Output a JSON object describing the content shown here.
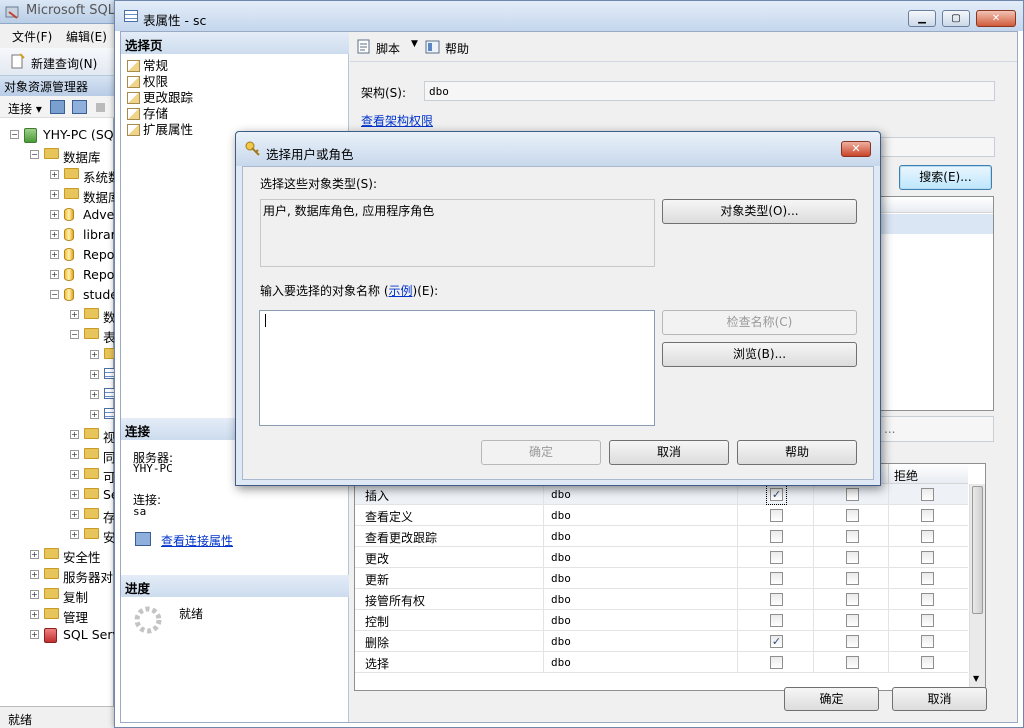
{
  "ssms": {
    "title": "Microsoft SQL",
    "menu": [
      "文件(F)",
      "编辑(E)"
    ],
    "new_query": "新建查询(N)",
    "object_explorer": {
      "header": "对象资源管理器",
      "connect": "连接",
      "tree": [
        {
          "label": "YHY-PC (SQ",
          "icon": "server-icon",
          "level": 0,
          "expander": "−"
        },
        {
          "label": "数据库",
          "icon": "folder-icon",
          "level": 1,
          "expander": "−"
        },
        {
          "label": "系统数",
          "icon": "folder-icon",
          "level": 2,
          "expander": "+"
        },
        {
          "label": "数据库",
          "icon": "folder-icon",
          "level": 2,
          "expander": "+"
        },
        {
          "label": "Adve",
          "icon": "database-icon",
          "level": 2,
          "expander": "+"
        },
        {
          "label": "librar",
          "icon": "database-icon",
          "level": 2,
          "expander": "+"
        },
        {
          "label": "Repo",
          "icon": "database-icon",
          "level": 2,
          "expander": "+"
        },
        {
          "label": "Repo",
          "icon": "database-icon",
          "level": 2,
          "expander": "+"
        },
        {
          "label": "stude",
          "icon": "database-icon",
          "level": 2,
          "expander": "−"
        },
        {
          "label": "数",
          "icon": "folder-icon",
          "level": 3,
          "expander": "+"
        },
        {
          "label": "表",
          "icon": "folder-icon",
          "level": 3,
          "expander": "−"
        },
        {
          "label": "",
          "icon": "folder-icon",
          "level": 4,
          "expander": "+"
        },
        {
          "label": "",
          "icon": "table-icon",
          "level": 4,
          "expander": "+"
        },
        {
          "label": "",
          "icon": "table-icon",
          "level": 4,
          "expander": "+"
        },
        {
          "label": "",
          "icon": "table-icon",
          "level": 4,
          "expander": "+"
        },
        {
          "label": "视",
          "icon": "folder-icon",
          "level": 3,
          "expander": "+"
        },
        {
          "label": "同",
          "icon": "folder-icon",
          "level": 3,
          "expander": "+"
        },
        {
          "label": "可",
          "icon": "folder-icon",
          "level": 3,
          "expander": "+"
        },
        {
          "label": "Se",
          "icon": "folder-icon",
          "level": 3,
          "expander": "+"
        },
        {
          "label": "存",
          "icon": "folder-icon",
          "level": 3,
          "expander": "+"
        },
        {
          "label": "安",
          "icon": "folder-icon",
          "level": 3,
          "expander": "+"
        },
        {
          "label": "安全性",
          "icon": "folder-icon",
          "level": 1,
          "expander": "+"
        },
        {
          "label": "服务器对",
          "icon": "folder-icon",
          "level": 1,
          "expander": "+"
        },
        {
          "label": "复制",
          "icon": "folder-icon",
          "level": 1,
          "expander": "+"
        },
        {
          "label": "管理",
          "icon": "folder-icon",
          "level": 1,
          "expander": "+"
        },
        {
          "label": "SQL Serv",
          "icon": "agent-icon",
          "level": 1,
          "expander": "+"
        }
      ]
    },
    "status": "就绪"
  },
  "props": {
    "title": "表属性 - sc",
    "select_page_header": "选择页",
    "pages": [
      "常规",
      "权限",
      "更改跟踪",
      "存储",
      "扩展属性"
    ],
    "connection_header": "连接",
    "server_label": "服务器:",
    "server_value": "YHY-PC",
    "conn_label": "连接:",
    "conn_value": "sa",
    "view_conn_props": "查看连接属性",
    "progress_header": "进度",
    "progress_status": "就绪",
    "toolbar_script": "脚本",
    "toolbar_help": "帮助",
    "schema_label": "架构(S):",
    "schema_value": "dbo",
    "view_schema_perms": "查看架构权限",
    "search_button": "搜索(E)...",
    "grid_deny_header": "拒绝",
    "grid_row_partial_text": "...",
    "grid_rows": [
      {
        "perm": "插入",
        "grantor": "dbo",
        "grant": true,
        "with_grant": false,
        "deny": false
      },
      {
        "perm": "查看定义",
        "grantor": "dbo",
        "grant": false,
        "with_grant": false,
        "deny": false
      },
      {
        "perm": "查看更改跟踪",
        "grantor": "dbo",
        "grant": false,
        "with_grant": false,
        "deny": false
      },
      {
        "perm": "更改",
        "grantor": "dbo",
        "grant": false,
        "with_grant": false,
        "deny": false
      },
      {
        "perm": "更新",
        "grantor": "dbo",
        "grant": false,
        "with_grant": false,
        "deny": false
      },
      {
        "perm": "接管所有权",
        "grantor": "dbo",
        "grant": false,
        "with_grant": false,
        "deny": false
      },
      {
        "perm": "控制",
        "grantor": "dbo",
        "grant": false,
        "with_grant": false,
        "deny": false
      },
      {
        "perm": "删除",
        "grantor": "dbo",
        "grant": true,
        "with_grant": false,
        "deny": false
      },
      {
        "perm": "选择",
        "grantor": "dbo",
        "grant": false,
        "with_grant": false,
        "deny": false
      }
    ],
    "ok": "确定",
    "cancel": "取消"
  },
  "dialog": {
    "title": "选择用户或角色",
    "object_types_label": "选择这些对象类型(S):",
    "object_types_value": "用户, 数据库角色, 应用程序角色",
    "object_types_button": "对象类型(O)...",
    "names_label_prefix": "输入要选择的对象名称 (",
    "names_label_link": "示例",
    "names_label_suffix": ")(E):",
    "names_value": "",
    "check_names_button": "检查名称(C)",
    "browse_button": "浏览(B)...",
    "ok_button": "确定",
    "cancel_button": "取消",
    "help_button": "帮助"
  },
  "colors": {
    "accent": "#3c7fb1",
    "link": "#0033cc",
    "close_red": "#c9452a"
  }
}
